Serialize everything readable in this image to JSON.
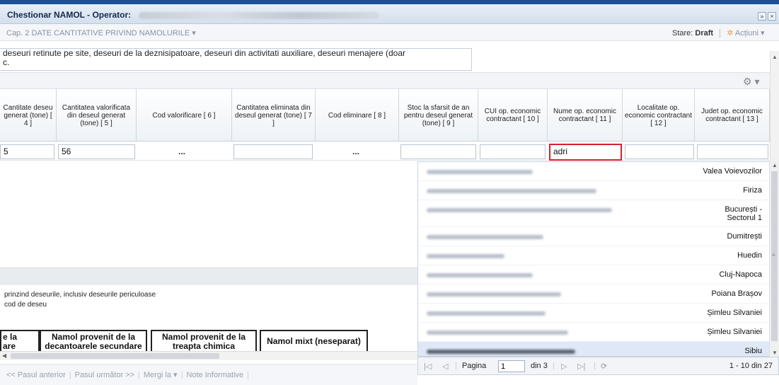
{
  "window": {
    "title": "Chestionar NAMOL - Operator:",
    "restore_icon": "restore-icon",
    "close_icon": "close-icon"
  },
  "toolbar": {
    "chapter": "Cap. 2 DATE CANTITATIVE PRIVIND NAMOLURILE ▾",
    "stare_label": "Stare:",
    "stare_value": "Draft",
    "actiuni": "Acțiuni ▾"
  },
  "textarea": {
    "line1": "deseuri retinute pe site, deseuri de la deznisipatoare, deseuri din activitati auxiliare, deseuri menajere (doar",
    "line2": "c."
  },
  "grid": {
    "headers": [
      "Cantitate deseu generat (tone) [ 4 ]",
      "Cantitatea valorificata din deseul generat (tone) [ 5 ]",
      "Cod valorificare [ 6 ]",
      "Cantitatea eliminata din deseul generat (tone) [ 7 ]",
      "Cod eliminare [ 8 ]",
      "Stoc la sfarsit de an pentru deseul generat (tone) [ 9 ]",
      "CUI op. economic contractant [ 10 ]",
      "Nume op. economic contractant [ 11 ]",
      "Localitate op. economic contractant [ 12 ]",
      "Judet op. economic contractant [ 13 ]"
    ],
    "row": {
      "cantitate": "5",
      "valorificata": "56",
      "cod_valorificare": "...",
      "cod_eliminare": "...",
      "nume": "adri"
    }
  },
  "dropdown": {
    "cities": [
      "Valea Voievozilor",
      "Firiza",
      "București - Sectorul 1",
      "Dumitrești",
      "Huedin",
      "Cluj-Napoca",
      "Poiana Brașov",
      "Șimleu Silvaniei",
      "Șimleu Silvaniei",
      "Sibiu"
    ]
  },
  "pager": {
    "page_label": "Pagina",
    "page_value": "1",
    "of_label": "din 3",
    "count": "1 - 10 din 27"
  },
  "notes": {
    "line1": "prinzind deseurile, inclusiv deseurile periculoase",
    "line2": "cod de deseu"
  },
  "bottom_table": {
    "col1": "e la\nare",
    "col2": "Namol provenit de la decantoarele secundare",
    "col3": "Namol provenit de la treapta chimica",
    "col4": "Namol mixt (neseparat)"
  },
  "nav": {
    "prev": "<< Pasul anterior",
    "next": "Pasul următor >>",
    "goto": "Mergi la ▾",
    "info": "Note Informative"
  },
  "colors": {
    "top_bar": "#1c4f94",
    "active_border": "#d6212a"
  }
}
